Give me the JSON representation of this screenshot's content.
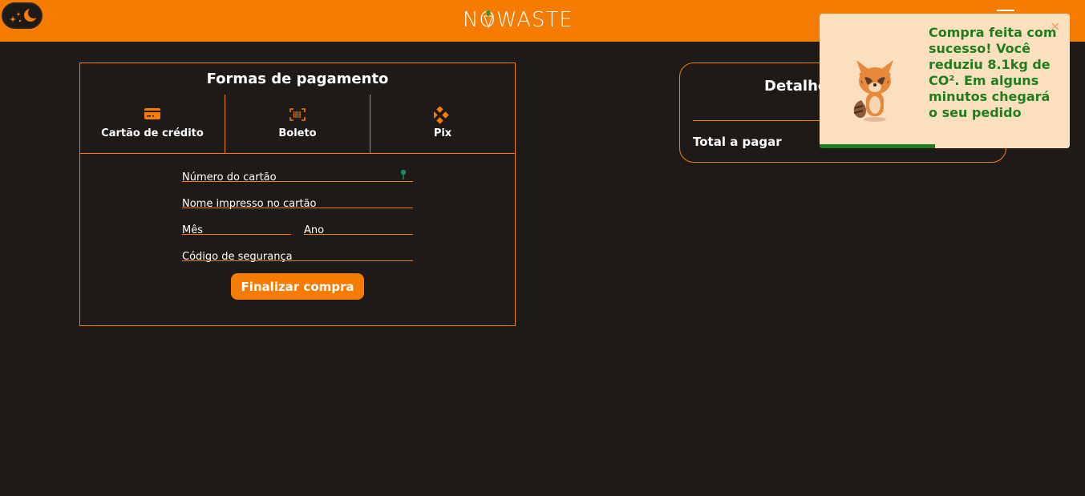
{
  "header": {
    "brand": "NOWASTE"
  },
  "payment": {
    "title": "Formas de pagamento",
    "methods": [
      {
        "label": "Cartão de crédito",
        "icon": "credit-card-icon"
      },
      {
        "label": "Boleto",
        "icon": "barcode-icon"
      },
      {
        "label": "Pix",
        "icon": "pix-icon"
      }
    ],
    "fields": {
      "card_number": {
        "placeholder": "Número do cartão",
        "value": ""
      },
      "card_name": {
        "placeholder": "Nome impresso no cartão",
        "value": ""
      },
      "month": {
        "placeholder": "Mês",
        "value": ""
      },
      "year": {
        "placeholder": "Ano",
        "value": ""
      },
      "security_code": {
        "placeholder": "Código de segurança",
        "value": ""
      }
    },
    "submit_label": "Finalizar compra"
  },
  "details": {
    "title": "Detalhes",
    "total_label": "Total a pagar"
  },
  "toast": {
    "message": "Compra feita com sucesso! Você reduziu 8.1kg de CO². Em alguns minutos chegará o seu pedido",
    "close_glyph": "×",
    "progress": 0.46,
    "text_color": "#1e7e1e",
    "background": "#fbe0c0"
  },
  "colors": {
    "accent": "#f57c00",
    "background": "#1e1a18"
  }
}
